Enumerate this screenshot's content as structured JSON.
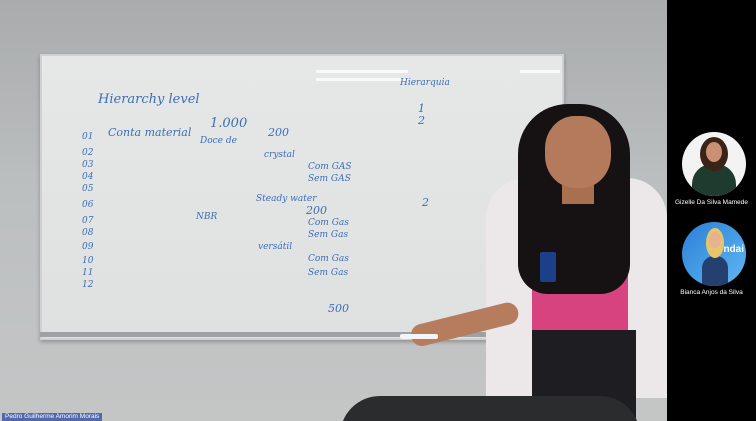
{
  "meeting": {
    "active_speaker": {
      "name": "Pedro Guilherme Amorim Morais"
    },
    "participants": [
      {
        "name": "Gizelle Da Silva Mamede",
        "avatar": "woman-portrait-photo"
      },
      {
        "name": "Bianca Anjos da Silva",
        "avatar": "woman-blue-background-photo",
        "avatar_text": "ndai"
      }
    ]
  },
  "whiteboard": {
    "title": "Hierarchy level",
    "top_right": "Hierarquia",
    "col_numbers": [
      "01",
      "02",
      "03",
      "04",
      "05",
      "06",
      "07",
      "08",
      "09",
      "10",
      "11",
      "12"
    ],
    "rows": [
      "Conta material",
      "Doce de",
      "crystal",
      "Com GAS",
      "Sem GAS",
      "Steady water",
      "Com Gas",
      "Sem Gas",
      "versátil",
      "Com Gas",
      "Sem Gas"
    ],
    "values": [
      "1.000",
      "200",
      "200",
      "500"
    ],
    "side_numbers": [
      "1",
      "2",
      "2"
    ],
    "mid_label": "NBR"
  },
  "colors": {
    "marker": "#3d6db4",
    "label_bg": "#3e58a8"
  }
}
